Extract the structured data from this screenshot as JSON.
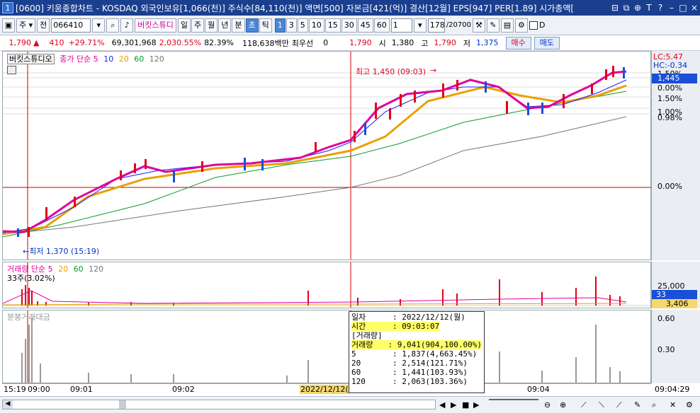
{
  "window": {
    "number": "1",
    "title": "[0600] 키움종합차트 - KOSDAQ 외국인보유[1,066(천)] 주식수[84,110(천)] 액면[500] 자본금[421(억)] 결산[12월] EPS[947] PER[1.89] 시가총액[",
    "buttons": [
      "⊟",
      "⧉",
      "⊕",
      "T",
      "?",
      "–",
      "□",
      "×"
    ]
  },
  "toolbar": {
    "period_select": "주",
    "prev_label": "전",
    "code_value": "066410",
    "stock_name": "버킷스튜디",
    "intervals": [
      "일",
      "주",
      "월",
      "년",
      "분",
      "초",
      "틱"
    ],
    "active_interval": "초",
    "steps": [
      "1",
      "3",
      "5",
      "10",
      "15",
      "30",
      "45",
      "60"
    ],
    "active_step": "1",
    "unit_value": "1",
    "count_value": "178",
    "count_total": "/20700",
    "checkbox_label": "D"
  },
  "quote": {
    "price": "1,790",
    "change": "410",
    "change_pct": "+29.71%",
    "volume": "69,301,968",
    "volume_pct": "2,030.55%",
    "ratio": "82.39%",
    "amount": "118,638백만",
    "pref_label": "최우선",
    "pref_value": "0",
    "best_price": "1,790",
    "open_label": "시",
    "open": "1,380",
    "high_label": "고",
    "high": "1,790",
    "low_label": "저",
    "low": "1,375",
    "buy_label": "매수",
    "sell_label": "매도"
  },
  "price_panel": {
    "name": "버킷스튜디오",
    "legend_prefix": "종가 단순",
    "ma": [
      {
        "label": "5",
        "color": "#e0009c"
      },
      {
        "label": "10",
        "color": "#1a1aff"
      },
      {
        "label": "20",
        "color": "#e8a000"
      },
      {
        "label": "60",
        "color": "#0a9a2a"
      },
      {
        "label": "120",
        "color": "#777777"
      }
    ],
    "high_annotation": "최고 1,450 (09:03)",
    "low_annotation": "←최저 1,370 (15:19)",
    "axis": {
      "lc": "LC:5.47",
      "hc": "HC:-0.34",
      "labels": [
        "1.50%",
        "0.00%",
        "1.50%",
        "1.00%",
        "0.98%",
        "0.00%"
      ],
      "current": "1,445"
    }
  },
  "volume_panel": {
    "legend_prefix": "거래량 단순",
    "ma": [
      {
        "label": "5",
        "color": "#e0009c"
      },
      {
        "label": "20",
        "color": "#e8a000"
      },
      {
        "label": "60",
        "color": "#0a9a2a"
      },
      {
        "label": "120",
        "color": "#777777"
      }
    ],
    "sub_label": "33주(3.02%)",
    "axis_top": "25,000",
    "current": "33",
    "current2": "3,406"
  },
  "amount_panel": {
    "legend": "분봉거래대금",
    "axis": [
      "0.60",
      "0.30"
    ]
  },
  "time_axis": {
    "labels": [
      "15:19",
      "09:00",
      "09:01",
      "09:02",
      "09:04"
    ],
    "cursor_label": "2022/12/12(",
    "right_label": "09:04:29"
  },
  "tooltip": {
    "rows": [
      {
        "k": "일자",
        "v": ": 2022/12/12(월)",
        "hl": false
      },
      {
        "k": "시간",
        "v": ": 09:03:07",
        "hl": true
      },
      {
        "k": "[거래량]",
        "v": "",
        "hl": false
      },
      {
        "k": " 거래량",
        "v": ": 9,041(904,100.00%)",
        "hl": true
      },
      {
        "k": "  5",
        "v": ": 1,837(4,663.45%)",
        "hl": false
      },
      {
        "k": "  20",
        "v": ": 2,514(121.71%)",
        "hl": false
      },
      {
        "k": "  60",
        "v": ": 1,441(103.93%)",
        "hl": false
      },
      {
        "k": "  120",
        "v": ": 2,063(103.36%)",
        "hl": false
      }
    ]
  },
  "colors": {
    "up": "#e0001b",
    "down": "#1a4fd6",
    "title_bg": "#1b3f8f",
    "crosshair": "#cc0000"
  }
}
